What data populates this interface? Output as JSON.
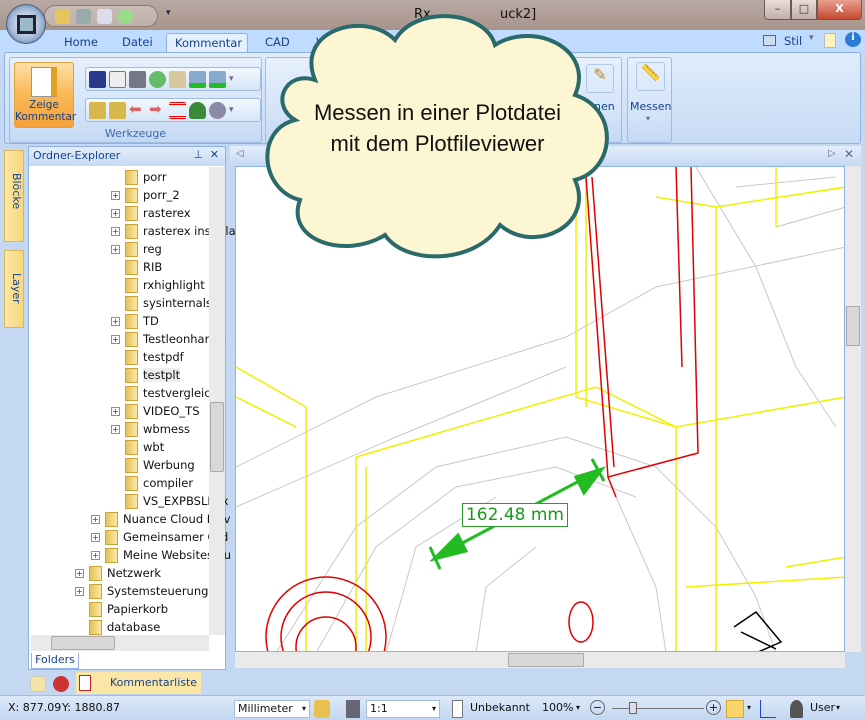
{
  "title": {
    "left_fragment": "Rx",
    "right_fragment": "uck2]"
  },
  "window_buttons": {
    "minimize": "–",
    "maximize": "□",
    "close": "X"
  },
  "tabs": [
    "Home",
    "Datei",
    "Kommentar",
    "CAD",
    "We"
  ],
  "active_tab": "Kommentar",
  "ribbon": {
    "big_button": "Zeige Kommentar",
    "group_label": "Werkzeuge",
    "partial_button": "nen",
    "measure_button": "Messen",
    "style_label": "Stil"
  },
  "cloud": {
    "line1": "Messen in einer Plotdatei",
    "line2": "mit dem Plotfileviewer"
  },
  "side_tabs": [
    "Blöcke",
    "Layer"
  ],
  "folder_pane": {
    "title": "Ordner-Explorer",
    "bottom_tab": "Folders",
    "items": [
      {
        "label": "porr",
        "plus": false,
        "level": 3
      },
      {
        "label": "porr_2",
        "plus": true,
        "level": 3
      },
      {
        "label": "rasterex",
        "plus": true,
        "level": 3
      },
      {
        "label": "rasterex installa",
        "plus": true,
        "level": 3
      },
      {
        "label": "reg",
        "plus": true,
        "level": 3
      },
      {
        "label": "RIB",
        "plus": false,
        "level": 3
      },
      {
        "label": "rxhighlight",
        "plus": false,
        "level": 3
      },
      {
        "label": "sysinternals",
        "plus": false,
        "level": 3
      },
      {
        "label": "TD",
        "plus": true,
        "level": 3
      },
      {
        "label": "Testleonhardw",
        "plus": true,
        "level": 3
      },
      {
        "label": "testpdf",
        "plus": false,
        "level": 3
      },
      {
        "label": "testplt",
        "plus": false,
        "level": 3
      },
      {
        "label": "testvergleich",
        "plus": false,
        "level": 3
      },
      {
        "label": "VIDEO_TS",
        "plus": true,
        "level": 3
      },
      {
        "label": "wbmess",
        "plus": true,
        "level": 3
      },
      {
        "label": "wbt",
        "plus": false,
        "level": 3
      },
      {
        "label": "Werbung",
        "plus": false,
        "level": 3
      },
      {
        "label": "compiler",
        "plus": false,
        "level": 3
      },
      {
        "label": "VS_EXPBSLN_x",
        "plus": false,
        "level": 3
      },
      {
        "label": "Nuance Cloud Driv",
        "plus": true,
        "level": 2
      },
      {
        "label": "Gemeinsamer Ord",
        "plus": true,
        "level": 2
      },
      {
        "label": "Meine Websites au",
        "plus": true,
        "level": 2
      },
      {
        "label": "Netzwerk",
        "plus": true,
        "level": 1
      },
      {
        "label": "Systemsteuerung",
        "plus": true,
        "level": 1
      },
      {
        "label": "Papierkorb",
        "plus": false,
        "level": 1
      },
      {
        "label": "database",
        "plus": false,
        "level": 1
      }
    ],
    "selected": "testplt"
  },
  "measurement": {
    "value": "162.48 mm"
  },
  "bottom_tabs": {
    "label": "Kommentarliste"
  },
  "status": {
    "x": "X: 877.09",
    "y": "Y: 1880.87",
    "unit": "Millimeter",
    "scale": "1:1",
    "paper": "Unbekannt",
    "zoom": "100%",
    "user": "User",
    "zoom_slider": 0.2
  },
  "colors": {
    "accent": "#15428b",
    "measure": "#22bb22"
  }
}
